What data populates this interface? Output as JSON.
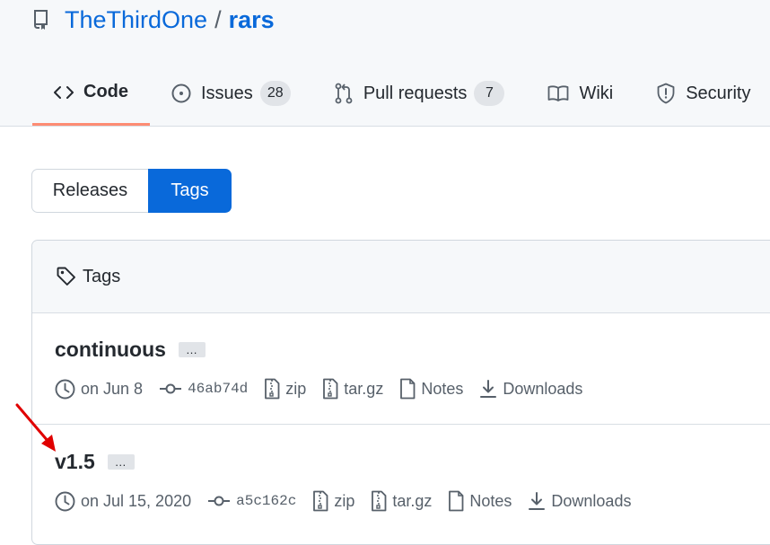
{
  "repo": {
    "owner": "TheThirdOne",
    "separator": "/",
    "name": "rars"
  },
  "nav": {
    "tabs": [
      {
        "label": "Code",
        "icon": "code-icon",
        "active": true
      },
      {
        "label": "Issues",
        "icon": "issue-opened-icon",
        "count": "28"
      },
      {
        "label": "Pull requests",
        "icon": "git-pull-request-icon",
        "count": "7"
      },
      {
        "label": "Wiki",
        "icon": "book-icon"
      },
      {
        "label": "Security",
        "icon": "shield-icon"
      }
    ]
  },
  "segmented": {
    "releases": "Releases",
    "tags": "Tags"
  },
  "box": {
    "header": "Tags",
    "header_icon": "tag-icon"
  },
  "tags": [
    {
      "name": "continuous",
      "more": "…",
      "date": "on Jun 8",
      "sha": "46ab74d",
      "zip": "zip",
      "targz": "tar.gz",
      "notes": "Notes",
      "downloads": "Downloads"
    },
    {
      "name": "v1.5",
      "more": "…",
      "date": "on Jul 15, 2020",
      "sha": "a5c162c",
      "zip": "zip",
      "targz": "tar.gz",
      "notes": "Notes",
      "downloads": "Downloads"
    }
  ],
  "colors": {
    "accent": "#0969da",
    "tab_underline": "#fd8c73",
    "annotation_arrow": "#e00000"
  }
}
